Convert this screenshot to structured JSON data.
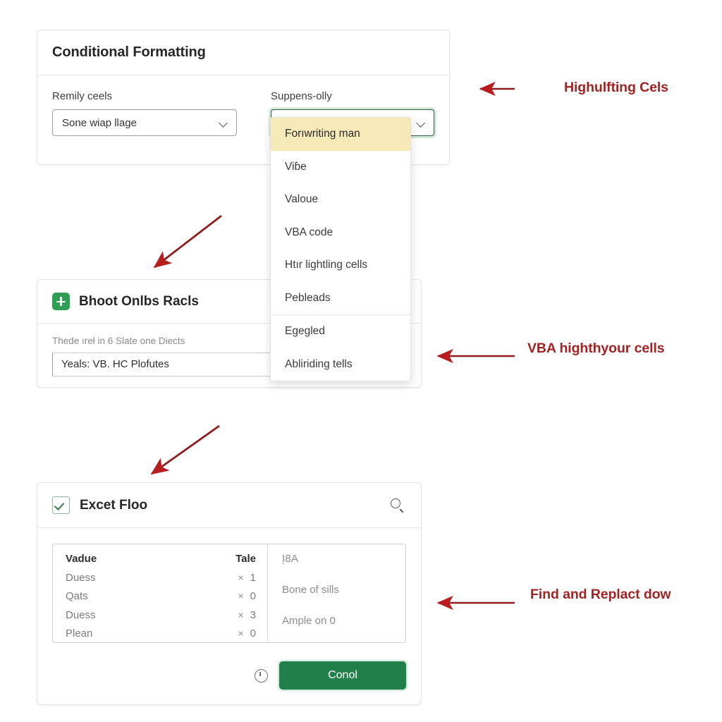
{
  "conditional_card": {
    "title": "Conditional Formatting",
    "fields": [
      {
        "label": "Remily ceels",
        "value": "Sone wiap llage",
        "chevron_icon": "chevron-down-icon"
      },
      {
        "label": "Suppens-olly",
        "value": "Forıwriting man",
        "chevron_icon": "chevron-down-icon"
      }
    ]
  },
  "dropdown": {
    "selected": "Forıwriting man",
    "items": [
      "Viɓe",
      "Valoue",
      "VBA code",
      "Htır lightling cells",
      "Pebleads",
      "Egegled",
      "Abliriding tells"
    ],
    "separator_after_index": 4
  },
  "bhoot_card": {
    "icon": "plus-square-icon",
    "title": "Bhoot Onlbs Racls",
    "hint": "Thede ıreł in 6 Slate one Diects",
    "input_value": "Yeals: VB. HC Plofutes"
  },
  "excel_card": {
    "icon": "checkbox-checked-icon",
    "title": "Excet Floo",
    "search_icon": "search-icon",
    "table": {
      "columns": [
        "Vadue",
        "Tale"
      ],
      "rows": [
        {
          "name": "Duess",
          "times": "×",
          "qty": "1"
        },
        {
          "name": "Qats",
          "times": "×",
          "qty": "0"
        },
        {
          "name": "Duess",
          "times": "×",
          "qty": "3"
        },
        {
          "name": "Plean",
          "times": "×",
          "qty": "0"
        }
      ]
    },
    "side_lines": [
      "I̩8A",
      "Bone of sills",
      "Ample on 0"
    ],
    "footer": {
      "clock_icon": "clock-icon",
      "primary_label": "Conol"
    }
  },
  "annotations": [
    {
      "text": "Highulfting Cels",
      "arrow": "left"
    },
    {
      "text": "VBA highthyour cells",
      "arrow": "left"
    },
    {
      "text": "Find and Replact dow",
      "arrow": "left"
    }
  ],
  "colors": {
    "annotation_red": "#a32222",
    "arrow_red": "#b81d1d",
    "primary_green": "#21804a",
    "badge_green": "#2e9e55",
    "highlight_yellow": "#f7e9b8"
  }
}
